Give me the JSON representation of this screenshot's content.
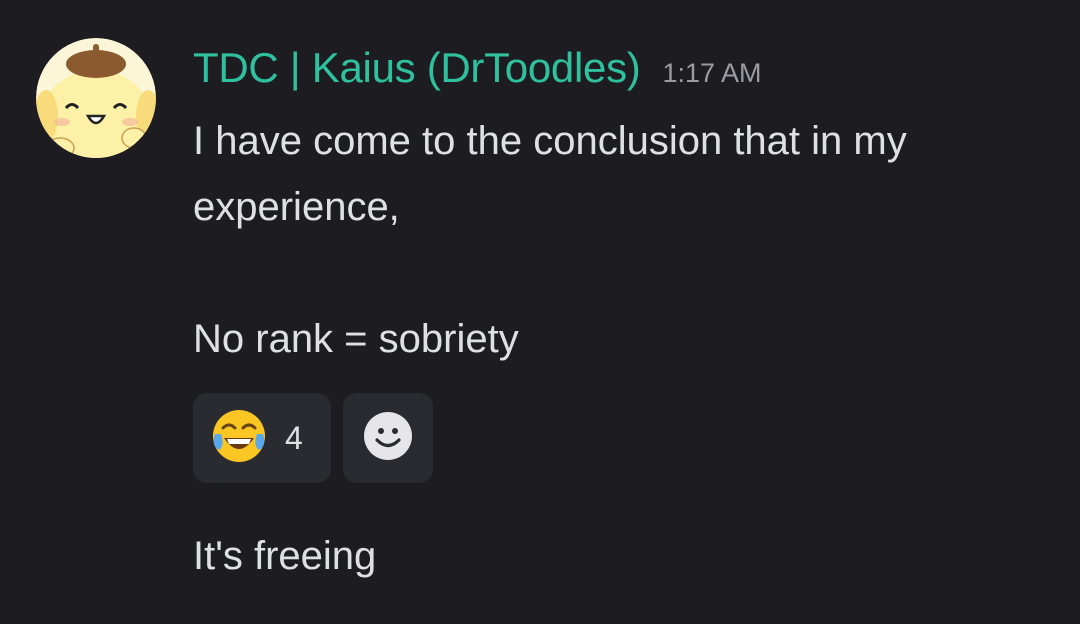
{
  "message": {
    "username": "TDC | Kaius (DrToodles)",
    "timestamp": "1:17 AM",
    "lines": [
      "I have come to the conclusion that in my",
      "experience,",
      "",
      "No rank = sobriety"
    ],
    "reactions": [
      {
        "emoji": "tears-of-joy-icon",
        "count": "4"
      }
    ],
    "add_reaction_icon": "smiley-icon",
    "followup": "It's freeing"
  },
  "colors": {
    "background": "#1d1d21",
    "username": "#2fc19e",
    "text": "#dfe0e4",
    "timestamp": "#9b9ca3",
    "reaction_bg": "#2a2b30"
  }
}
